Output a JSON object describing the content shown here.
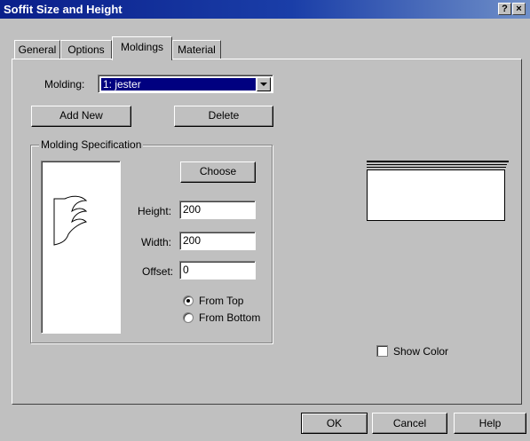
{
  "window": {
    "title": "Soffit Size and Height",
    "help_btn": "?",
    "close_btn": "×"
  },
  "tabs": [
    {
      "label": "General"
    },
    {
      "label": "Options"
    },
    {
      "label": "Moldings"
    },
    {
      "label": "Material"
    }
  ],
  "molding": {
    "label": "Molding:",
    "value": "1:  jester"
  },
  "buttons": {
    "add_new": "Add New",
    "delete": "Delete",
    "choose": "Choose"
  },
  "spec": {
    "legend": "Molding Specification",
    "height_label": "Height:",
    "height_value": "200",
    "width_label": "Width:",
    "width_value": "200",
    "offset_label": "Offset:",
    "offset_value": "0",
    "from_top": "From Top",
    "from_bottom": "From Bottom",
    "from_top_selected": true
  },
  "show_color": {
    "label": "Show Color",
    "checked": false
  },
  "footer": {
    "ok": "OK",
    "cancel": "Cancel",
    "help": "Help"
  },
  "colors": {
    "titlebar": "#0a1f8a",
    "selection": "#000080",
    "face": "#c0c0c0"
  }
}
